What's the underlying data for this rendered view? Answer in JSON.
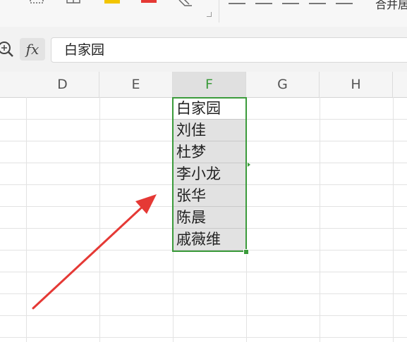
{
  "ribbon": {
    "merge_label": "合并居"
  },
  "formula_bar": {
    "fx_label": "fx",
    "value": "白家园"
  },
  "columns": [
    "D",
    "E",
    "F",
    "G",
    "H"
  ],
  "active_column": "F",
  "cells": [
    {
      "ref": "F1",
      "value": "白家园"
    },
    {
      "ref": "F2",
      "value": "刘佳"
    },
    {
      "ref": "F3",
      "value": "杜梦"
    },
    {
      "ref": "F4",
      "value": "李小龙"
    },
    {
      "ref": "F5",
      "value": "张华"
    },
    {
      "ref": "F6",
      "value": "陈晨"
    },
    {
      "ref": "F7",
      "value": "戚薇维"
    }
  ],
  "colors": {
    "selection": "#3b9b3b",
    "arrow": "#e53935"
  }
}
